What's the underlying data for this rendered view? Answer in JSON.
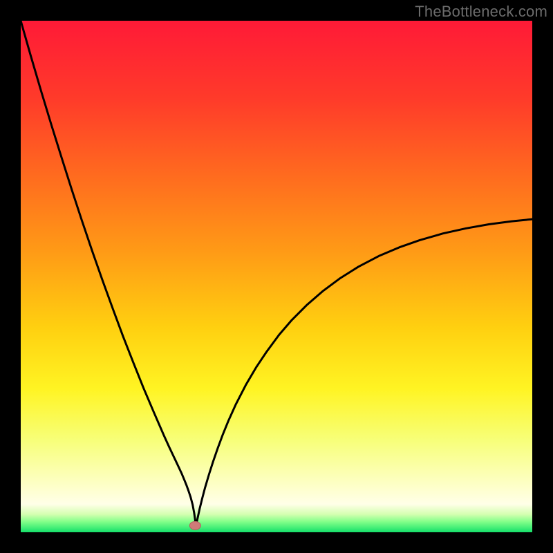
{
  "watermark": "TheBottleneck.com",
  "colors": {
    "gradient_stops": [
      {
        "offset": 0.0,
        "color": "#ff1a37"
      },
      {
        "offset": 0.15,
        "color": "#ff3a2a"
      },
      {
        "offset": 0.3,
        "color": "#ff6a1f"
      },
      {
        "offset": 0.45,
        "color": "#ff9a16"
      },
      {
        "offset": 0.6,
        "color": "#ffd010"
      },
      {
        "offset": 0.72,
        "color": "#fff423"
      },
      {
        "offset": 0.82,
        "color": "#f7ff79"
      },
      {
        "offset": 0.9,
        "color": "#fdffc0"
      },
      {
        "offset": 0.945,
        "color": "#ffffe8"
      },
      {
        "offset": 0.965,
        "color": "#d4ffb0"
      },
      {
        "offset": 0.98,
        "color": "#7fff88"
      },
      {
        "offset": 1.0,
        "color": "#15e06a"
      }
    ],
    "curve_stroke": "#000000",
    "marker_fill": "#cf7a78",
    "marker_stroke": "#b55f5d",
    "background": "#000000"
  },
  "chart_data": {
    "type": "line",
    "title": "",
    "xlabel": "",
    "ylabel": "",
    "xlim": [
      0,
      100
    ],
    "ylim": [
      0,
      100
    ],
    "grid": false,
    "legend": false,
    "series": [
      {
        "name": "bottleneck-curve",
        "x": [
          0.0,
          2.0,
          4.0,
          6.0,
          8.0,
          10.0,
          12.0,
          14.0,
          16.0,
          18.0,
          20.0,
          22.0,
          24.0,
          26.0,
          28.0,
          29.0,
          30.0,
          30.8,
          31.5,
          32.0,
          32.4,
          32.8,
          33.2,
          33.6,
          33.9,
          34.1,
          34.2,
          34.5,
          35.0,
          35.5,
          36.0,
          36.8,
          37.6,
          38.5,
          39.5,
          40.6,
          42.0,
          44.0,
          46.0,
          48.0,
          50.5,
          53.0,
          56.0,
          59.0,
          62.5,
          66.0,
          70.0,
          74.0,
          78.0,
          82.5,
          87.0,
          91.5,
          96.0,
          100.0
        ],
        "y": [
          100.0,
          93.0,
          86.2,
          79.6,
          73.2,
          66.9,
          60.8,
          54.9,
          49.2,
          43.7,
          38.3,
          33.2,
          28.2,
          23.5,
          18.9,
          16.7,
          14.6,
          12.9,
          11.4,
          10.2,
          9.2,
          8.1,
          6.9,
          5.4,
          3.8,
          2.4,
          1.2,
          2.4,
          4.7,
          6.7,
          8.6,
          11.3,
          13.8,
          16.4,
          19.1,
          21.8,
          24.9,
          28.8,
          32.2,
          35.2,
          38.6,
          41.5,
          44.5,
          47.1,
          49.7,
          51.9,
          54.0,
          55.7,
          57.1,
          58.4,
          59.4,
          60.2,
          60.8,
          61.2
        ]
      }
    ],
    "markers": [
      {
        "name": "optimal-point",
        "x": 34.1,
        "y": 1.3
      }
    ]
  }
}
